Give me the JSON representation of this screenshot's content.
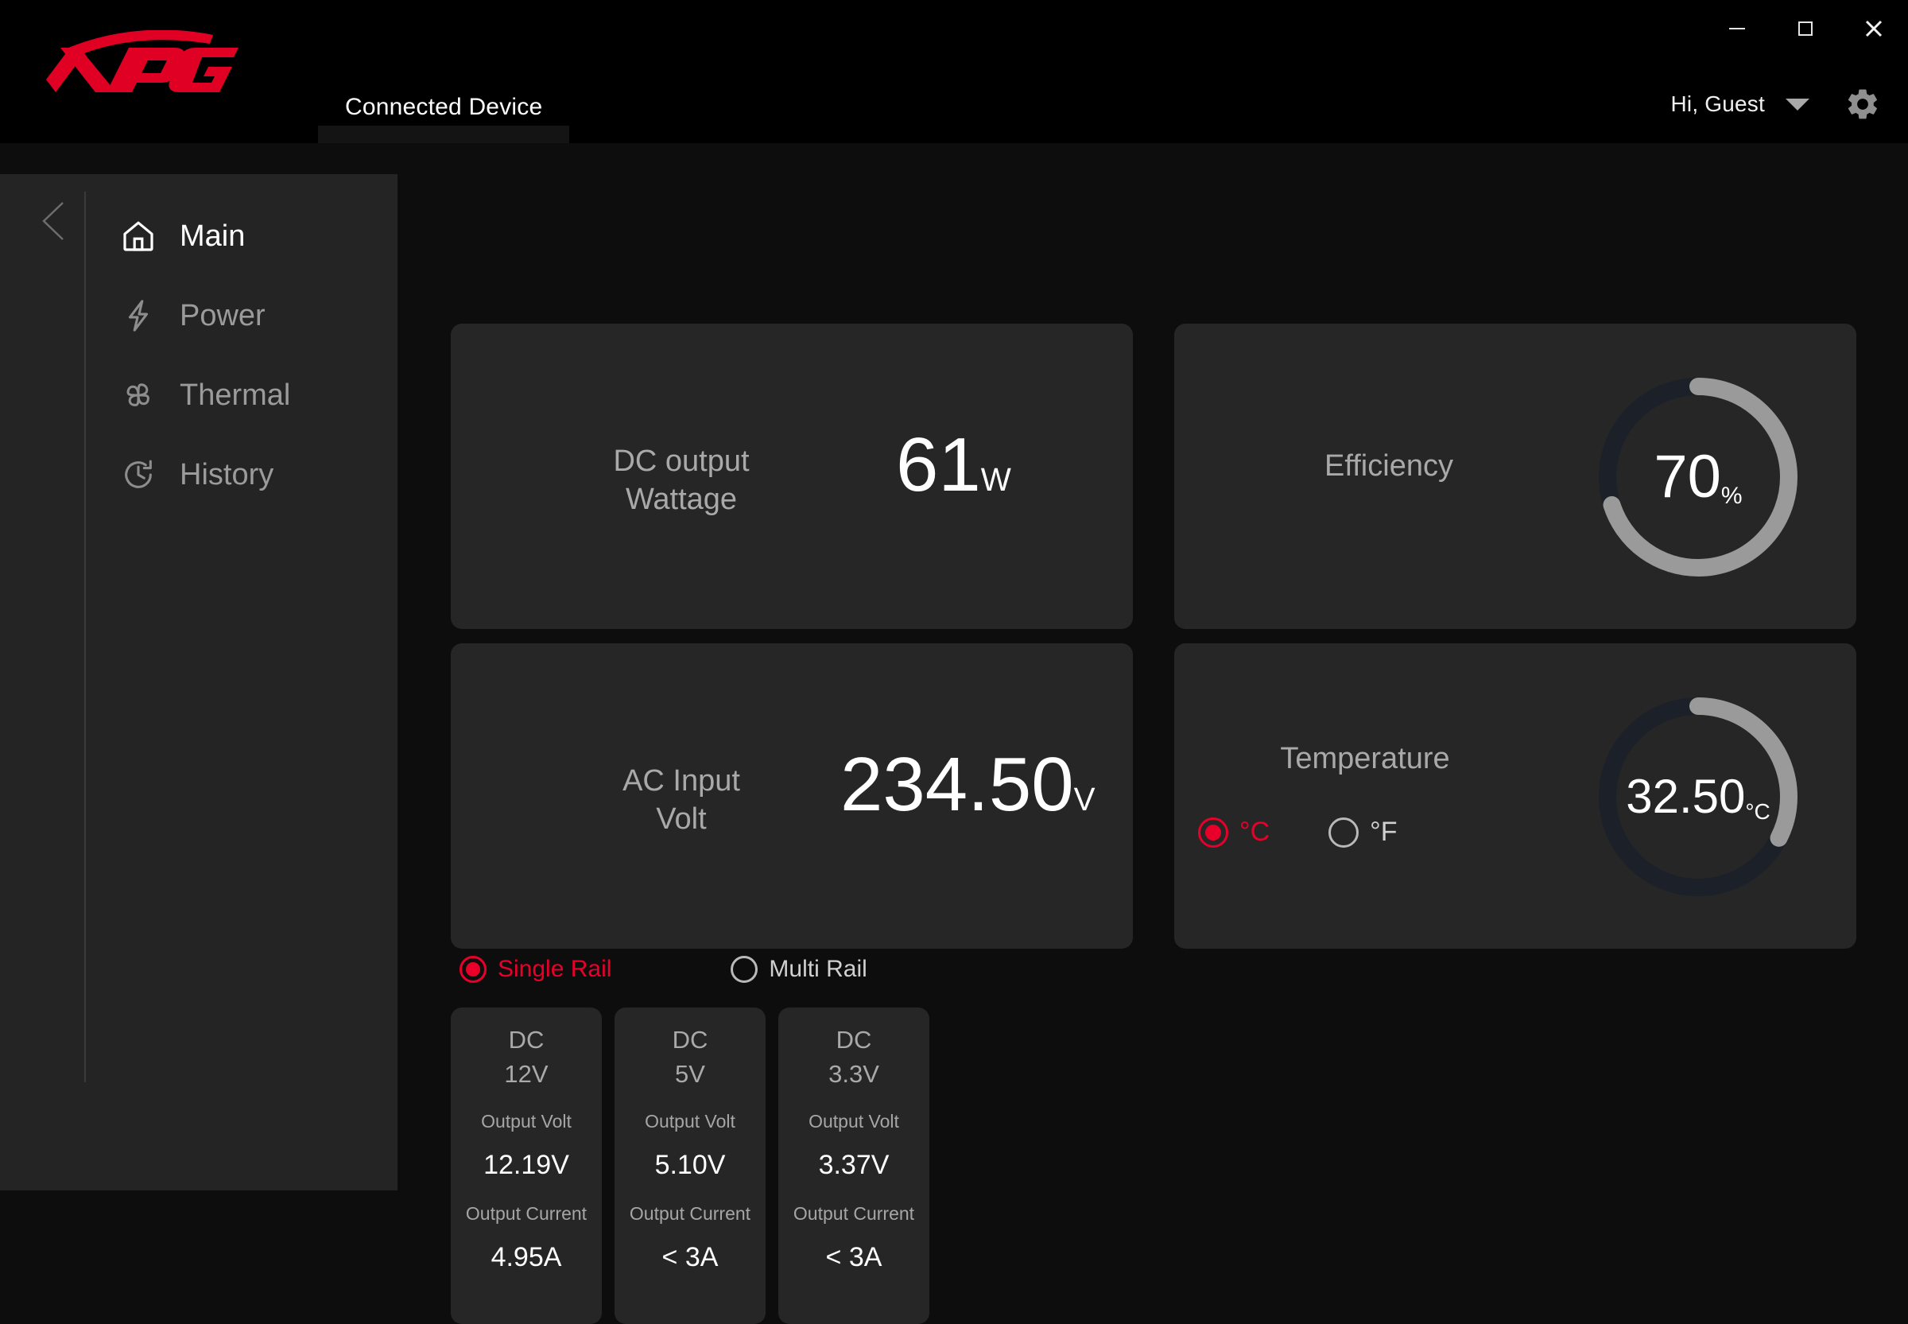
{
  "app": {
    "brand": "XPG",
    "accent": "#e8002a",
    "gauge_fill": "#9a9a9a",
    "gauge_track": "#1b2029"
  },
  "titlebar": {
    "minimize_label": "Minimize",
    "maximize_label": "Maximize",
    "close_label": "Close"
  },
  "tabs": [
    {
      "label": "Connected Device",
      "active": true
    }
  ],
  "user": {
    "greeting": "Hi, Guest"
  },
  "sidebar": {
    "items": [
      {
        "label": "Main",
        "icon": "home-icon",
        "active": true
      },
      {
        "label": "Power",
        "icon": "bolt-icon",
        "active": false
      },
      {
        "label": "Thermal",
        "icon": "fan-icon",
        "active": false
      },
      {
        "label": "History",
        "icon": "clock-icon",
        "active": false
      }
    ]
  },
  "main": {
    "wattage": {
      "label": "DC output Wattage",
      "label_line1": "DC output",
      "label_line2": "Wattage",
      "value": "61",
      "unit": "W"
    },
    "efficiency": {
      "label": "Efficiency",
      "value": "70",
      "unit": "%",
      "percent": 70
    },
    "ac_input": {
      "label": "AC Input Volt",
      "label_line1": "AC Input",
      "label_line2": "Volt",
      "value": "234.50",
      "unit": "V"
    },
    "temperature": {
      "label": "Temperature",
      "value": "32.50",
      "unit": "°C",
      "percent": 32.5,
      "units": [
        {
          "label": "°C",
          "selected": true
        },
        {
          "label": "°F",
          "selected": false
        }
      ]
    },
    "rail_mode": [
      {
        "label": "Single Rail",
        "selected": true
      },
      {
        "label": "Multi Rail",
        "selected": false
      }
    ],
    "rails": [
      {
        "dc": "DC",
        "rail": "12V",
        "volt_label": "Output Volt",
        "volt_value": "12.19V",
        "current_label": "Output Current",
        "current_value": "4.95A"
      },
      {
        "dc": "DC",
        "rail": "5V",
        "volt_label": "Output Volt",
        "volt_value": "5.10V",
        "current_label": "Output Current",
        "current_value": "< 3A"
      },
      {
        "dc": "DC",
        "rail": "3.3V",
        "volt_label": "Output Volt",
        "volt_value": "3.37V",
        "current_label": "Output Current",
        "current_value": "< 3A"
      }
    ]
  }
}
